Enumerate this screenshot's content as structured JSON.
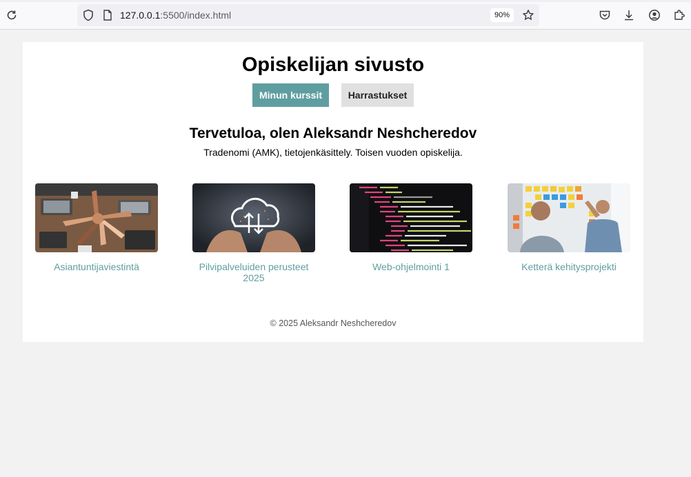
{
  "browser": {
    "url_host": "127.0.0.1",
    "url_path": ":5500/index.html",
    "zoom": "90%",
    "icons": [
      "reload-icon",
      "shield-icon",
      "page-icon",
      "bookmark-star-icon",
      "pocket-icon",
      "download-icon",
      "account-icon",
      "extensions-icon"
    ]
  },
  "site": {
    "title": "Opiskelijan sivusto",
    "nav": [
      {
        "label": "Minun kurssit",
        "active": true
      },
      {
        "label": "Harrastukset",
        "active": false
      }
    ],
    "welcome": "Tervetuloa, olen Aleksandr Neshcheredov",
    "subtitle": "Tradenomi (AMK), tietojenkäsittely. Toisen vuoden opiskelija.",
    "courses": [
      {
        "label": "Asiantuntijaviestintä"
      },
      {
        "label": "Pilvipalveluiden perusteet 2025"
      },
      {
        "label": "Web-ohjelmointi 1"
      },
      {
        "label": "Ketterä kehitysprojekti"
      }
    ],
    "footer": "© 2025 Aleksandr Neshcheredov"
  },
  "colors": {
    "accent": "#5f9ea0",
    "page_bg": "#f2f2f2",
    "card_bg": "#ffffff"
  }
}
